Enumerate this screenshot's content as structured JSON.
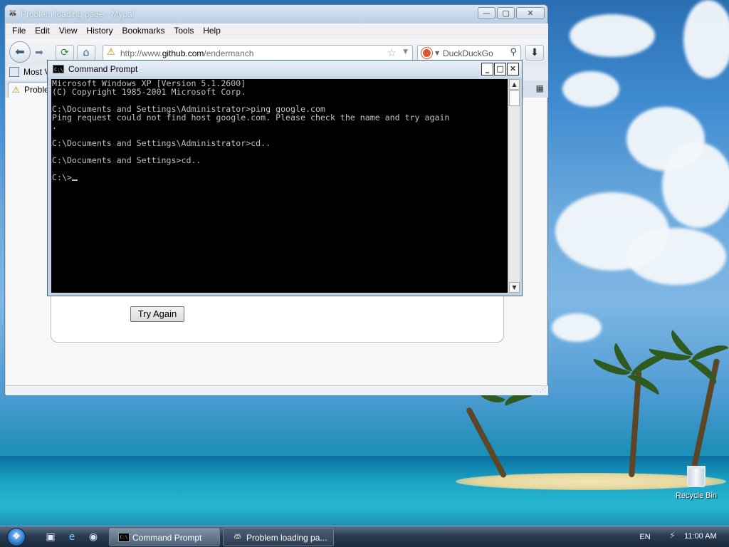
{
  "browser": {
    "window_title": "Problem loading page - Mypal",
    "window_buttons": {
      "minimize": "—",
      "maximize": "▢",
      "close": "✕"
    },
    "menu": [
      "File",
      "Edit",
      "View",
      "History",
      "Bookmarks",
      "Tools",
      "Help"
    ],
    "url": {
      "prefix": "http://www.",
      "domain": "github.com",
      "path": "/endermanch"
    },
    "search_placeholder": "DuckDuckGo",
    "bookmarks_item": "Most V",
    "tab_label": "Problem",
    "try_again_label": "Try Again"
  },
  "cmd": {
    "title": "Command Prompt",
    "icon_text": "C:\\",
    "lines": [
      "Microsoft Windows XP [Version 5.1.2600]",
      "(C) Copyright 1985-2001 Microsoft Corp.",
      "",
      "C:\\Documents and Settings\\Administrator>ping google.com",
      "Ping request could not find host google.com. Please check the name and try again",
      ".",
      "",
      "C:\\Documents and Settings\\Administrator>cd..",
      "",
      "C:\\Documents and Settings>cd..",
      "",
      "C:\\>"
    ]
  },
  "desktop": {
    "recycle_bin_label": "Recycle Bin"
  },
  "taskbar": {
    "buttons": [
      {
        "label": "Command Prompt",
        "active": true
      },
      {
        "label": "Problem loading pa...",
        "active": false
      }
    ],
    "language": "EN",
    "clock": "11:00 AM"
  }
}
